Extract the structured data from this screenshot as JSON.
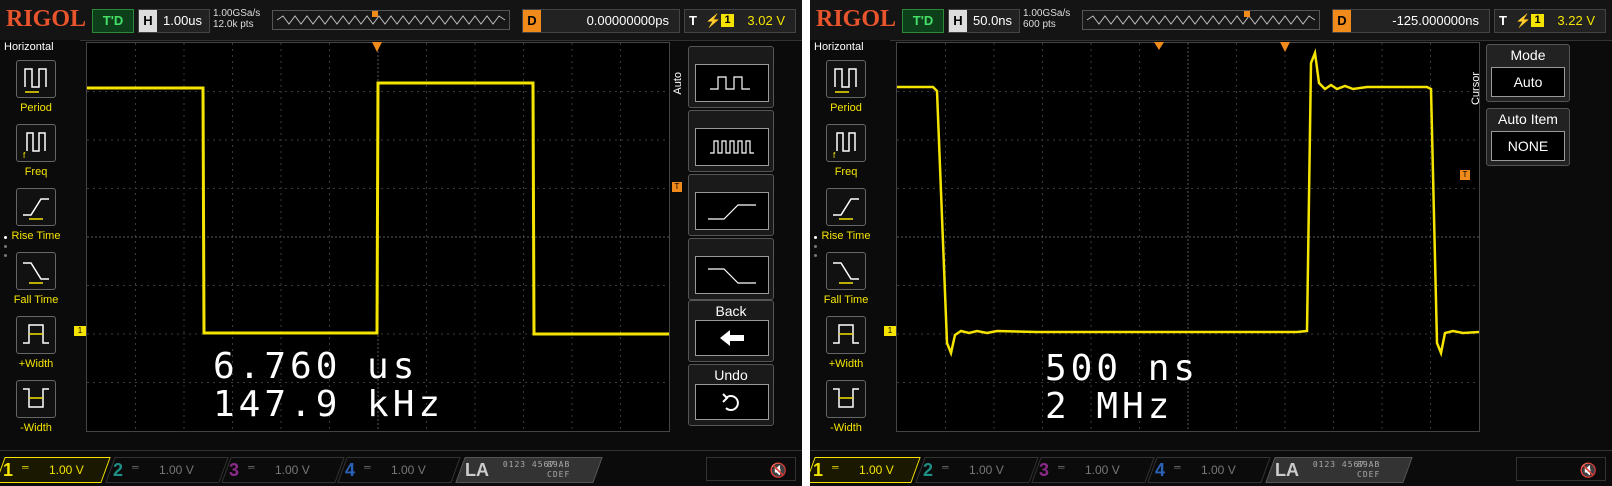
{
  "panels": [
    {
      "logo": "RIGOL",
      "run_status": "T'D",
      "timebase_key": "H",
      "timebase": "1.00us",
      "sample_rate": "1.00GSa/s",
      "memory_depth": "12.0k pts",
      "delay_key": "D",
      "delay": "0.00000000ps",
      "trigger_key": "T",
      "trigger_channel": "1",
      "trigger_level": "3.02 V",
      "menu_title": "Horizontal",
      "measure_items": [
        "Period",
        "Freq",
        "Rise Time",
        "Fall Time",
        "+Width",
        "-Width"
      ],
      "side_label": "Auto",
      "side_buttons": [
        "Back",
        "Undo"
      ],
      "readout_line1": "6.760 us",
      "readout_line2": "147.9 kHz",
      "channels": [
        {
          "num": "1",
          "value": "1.00 V"
        },
        {
          "num": "2",
          "value": "1.00 V"
        },
        {
          "num": "3",
          "value": "1.00 V"
        },
        {
          "num": "4",
          "value": "1.00 V"
        }
      ],
      "la_label": "LA",
      "la_bits_a": "0123 4567",
      "la_bits_b": "89AB CDEF"
    },
    {
      "logo": "RIGOL",
      "run_status": "T'D",
      "timebase_key": "H",
      "timebase": "50.0ns",
      "sample_rate": "1.00GSa/s",
      "memory_depth": "600 pts",
      "delay_key": "D",
      "delay": "-125.000000ns",
      "trigger_key": "T",
      "trigger_channel": "1",
      "trigger_level": "3.22 V",
      "menu_title": "Horizontal",
      "measure_items": [
        "Period",
        "Freq",
        "Rise Time",
        "Fall Time",
        "+Width",
        "-Width"
      ],
      "side_label": "Cursor",
      "mode_title": "Mode",
      "mode_value": "Auto",
      "auto_item_title": "Auto Item",
      "auto_item_value": "NONE",
      "readout_line1": "500 ns",
      "readout_line2": "2 MHz",
      "channels": [
        {
          "num": "1",
          "value": "1.00 V"
        },
        {
          "num": "2",
          "value": "1.00 V"
        },
        {
          "num": "3",
          "value": "1.00 V"
        },
        {
          "num": "4",
          "value": "1.00 V"
        }
      ],
      "la_label": "LA",
      "la_bits_a": "0123 4567",
      "la_bits_b": "89AB CDEF"
    }
  ],
  "colors": {
    "channel1": "#f5e400",
    "channel2": "#1f8f86",
    "channel3": "#8a2a88",
    "channel4": "#2b63b8",
    "trigger": "#f08a1a",
    "logo": "#e8542c"
  },
  "icons": {
    "measure": [
      "period-icon",
      "freq-icon",
      "rise-time-icon",
      "fall-time-icon",
      "pos-width-icon",
      "neg-width-icon"
    ],
    "audio": "speaker-muted-icon",
    "back": "back-arrow-icon",
    "undo": "undo-icon"
  }
}
